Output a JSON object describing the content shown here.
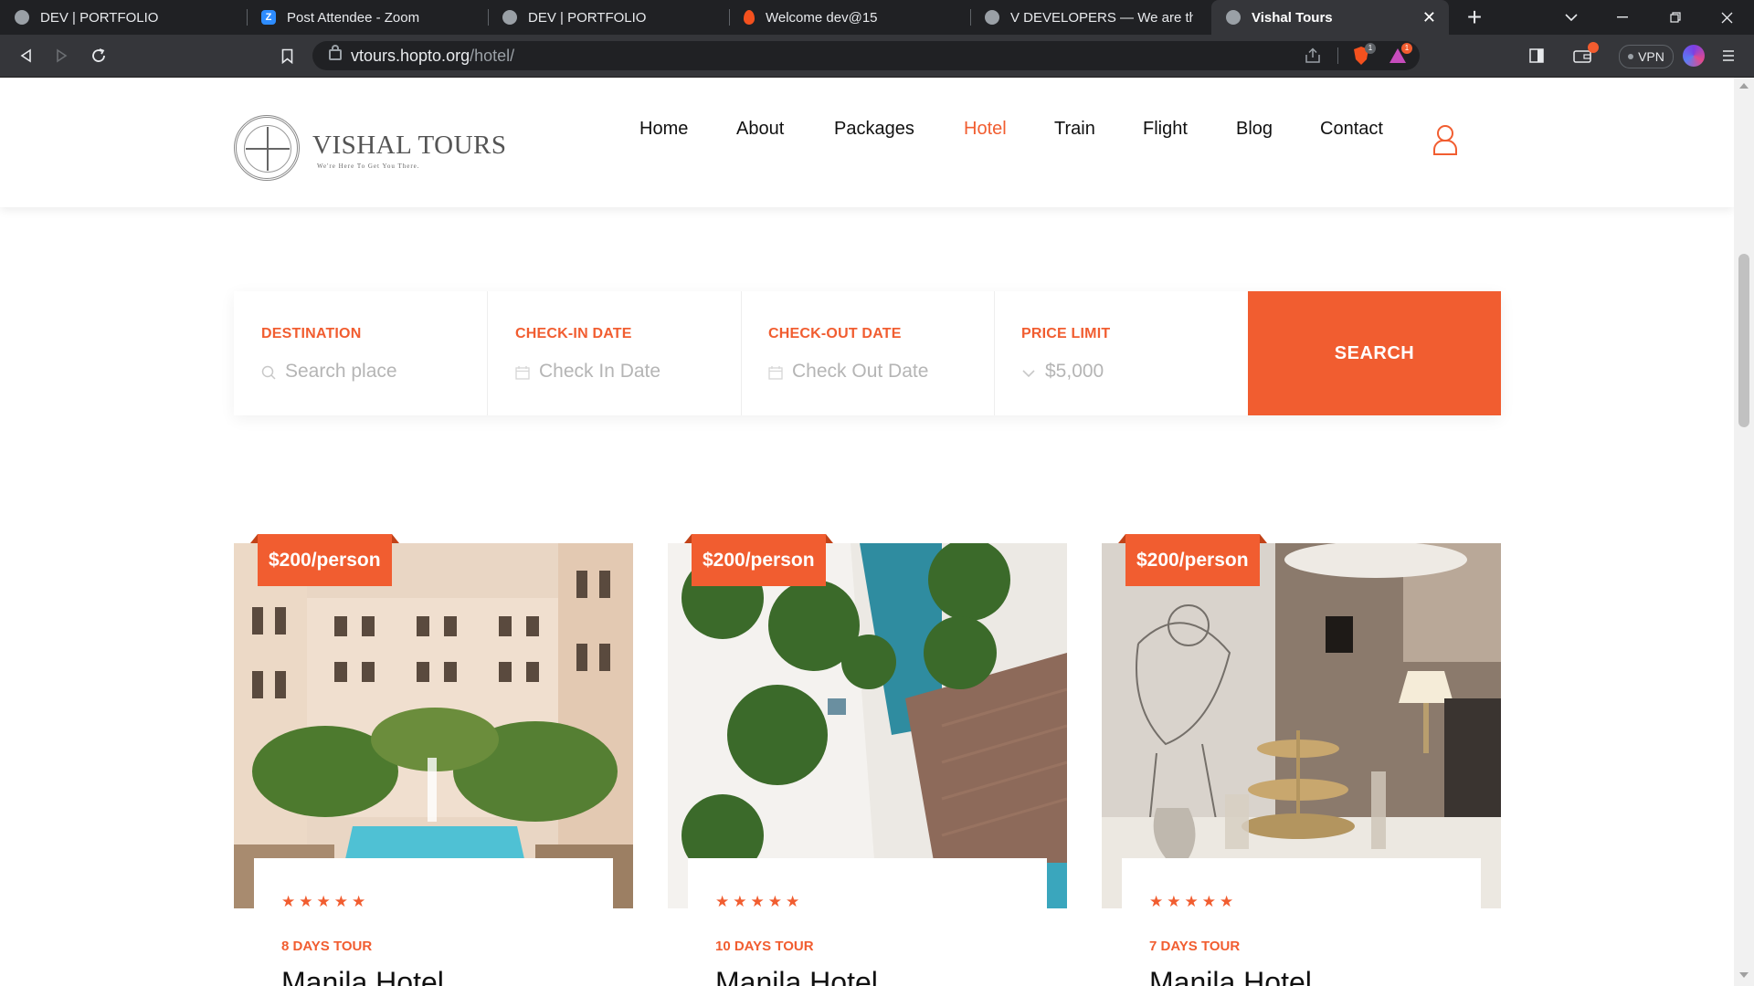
{
  "browser": {
    "tabs": [
      {
        "title": "DEV | PORTFOLIO",
        "icon": "globe-icon"
      },
      {
        "title": "Post Attendee - Zoom",
        "icon": "zoom-icon"
      },
      {
        "title": "DEV | PORTFOLIO",
        "icon": "globe-icon"
      },
      {
        "title": "Welcome dev@15",
        "icon": "fire-icon"
      },
      {
        "title": "V DEVELOPERS — We are the DE",
        "icon": "globe-icon"
      },
      {
        "title": "Vishal Tours",
        "icon": "globe-icon",
        "active": true
      }
    ],
    "close_tab_label": "✕",
    "new_tab_label": "+",
    "url_host": "vtours.hopto.org",
    "url_path": "/hotel/",
    "vpn_label": "VPN",
    "shield_badge": "1",
    "rewards_badge": "1"
  },
  "site": {
    "brand": "VISHAL TOURS",
    "tagline": "We're Here To Get You There.",
    "nav": [
      "Home",
      "About",
      "Packages",
      "Hotel",
      "Train",
      "Flight",
      "Blog",
      "Contact"
    ],
    "active_nav": "Hotel",
    "accent_color": "#f15d30"
  },
  "search": {
    "destination": {
      "label": "DESTINATION",
      "placeholder": "Search place",
      "icon": "search-icon"
    },
    "checkin": {
      "label": "CHECK-IN DATE",
      "placeholder": "Check In Date",
      "icon": "calendar-icon"
    },
    "checkout": {
      "label": "CHECK-OUT DATE",
      "placeholder": "Check Out Date",
      "icon": "calendar-icon"
    },
    "price": {
      "label": "PRICE LIMIT",
      "value": "$5,000",
      "icon": "chevron-down-icon"
    },
    "button_label": "SEARCH"
  },
  "cards": [
    {
      "price": "$200/person",
      "stars": "★★★★★",
      "rating": 5,
      "days": "8 DAYS TOUR",
      "name": "Manila Hotel"
    },
    {
      "price": "$200/person",
      "stars": "★★★★★",
      "rating": 5,
      "days": "10 DAYS TOUR",
      "name": "Manila Hotel"
    },
    {
      "price": "$200/person",
      "stars": "★★★★★",
      "rating": 5,
      "days": "7 DAYS TOUR",
      "name": "Manila Hotel"
    }
  ]
}
